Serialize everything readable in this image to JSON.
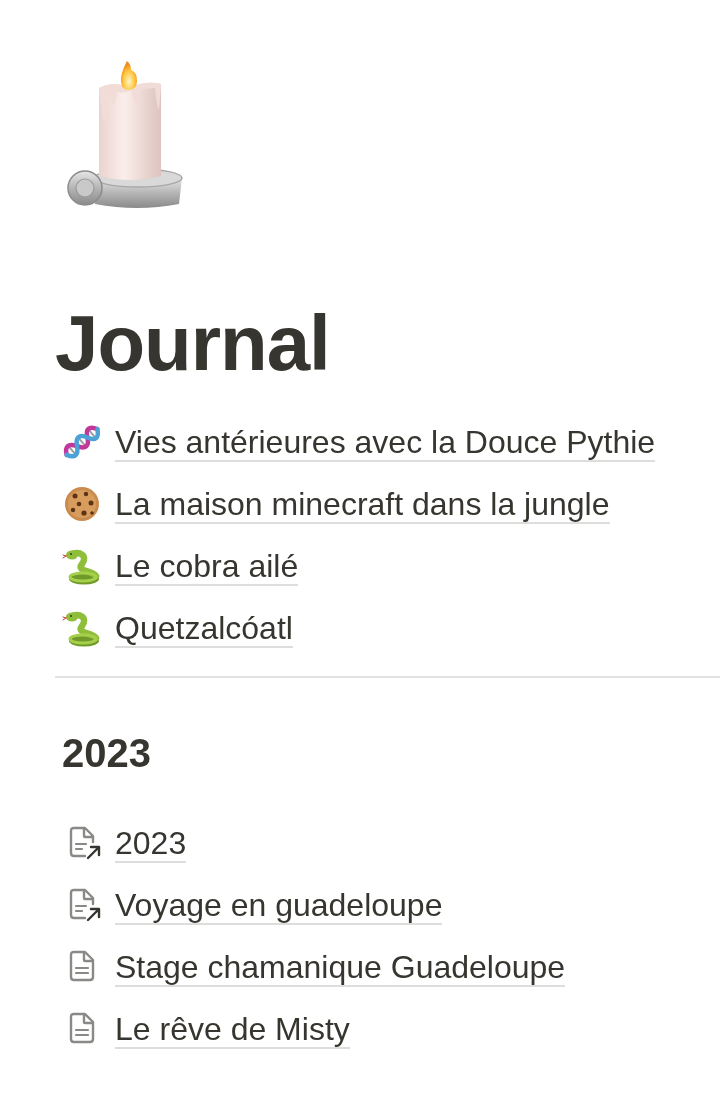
{
  "page": {
    "title": "Journal"
  },
  "links": [
    {
      "kind": "dna",
      "label": "Vies antérieures avec la Douce Pythie"
    },
    {
      "kind": "cookie",
      "label": "La maison minecraft dans la jungle"
    },
    {
      "kind": "snake",
      "label": "Le cobra ailé"
    },
    {
      "kind": "snake",
      "label": "Quetzalcóatl"
    }
  ],
  "section": {
    "heading": "2023",
    "pages": [
      {
        "kind": "linked",
        "label": "2023"
      },
      {
        "kind": "linked",
        "label": "Voyage en guadeloupe"
      },
      {
        "kind": "page",
        "label": "Stage chamanique Guadeloupe"
      },
      {
        "kind": "page",
        "label": "Le rêve de Misty"
      }
    ]
  }
}
